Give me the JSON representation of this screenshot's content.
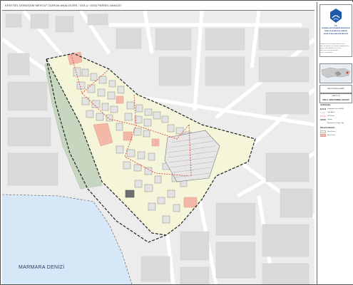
{
  "header": {
    "title": "KENTSEL DÖNÜŞÜM MEVCUT DURUM ANALİZLERİ / DOLU / BOŞ PARSEL ANALİZİ"
  },
  "map": {
    "sea_label": "MARMARA DENİZİ",
    "colors": {
      "background": "#ececec",
      "blocks": "#d9d9d9",
      "sea": "#d6e8f7",
      "park": "#c7d6bf",
      "built_parcel": "#f4f5d9",
      "empty_parcel": "#f4b8a8",
      "boundary": "#222222",
      "analysis_line": "#d83a3a"
    }
  },
  "sidebar": {
    "institution_lines": [
      "T.C.",
      "İSTANBUL BÜYÜKŞEHİR BELEDİYESİ",
      "İMAR VE ŞEHİRCİLİK DAİRESİ",
      "ŞEHİR PLANLAMA MÜDÜRLÜĞÜ"
    ],
    "description_lines": [
      "İSTANBUL BÜYÜKŞEHİR BELEDİYESİ",
      "İMAR VE ŞEHİRCİLİK DAİRESİ BAŞKANLIĞI",
      "ŞEHİR PLANLAMA MÜDÜRLÜĞÜ",
      "KENTSEL DÖNÜŞÜM ALANI",
      "TESPİT ÇALIŞMASI"
    ],
    "title": "Mevcut Durum Analizi",
    "subtitle_small": "ANALİZ 1A",
    "subtitle": "DOLU / BOŞ PARSEL ANALİZİ",
    "legend": {
      "heading": "Açıklamalar",
      "items": [
        {
          "label": "Proje Alanı Sınırı (Mülk)"
        },
        {
          "label": "Yapı Adası"
        },
        {
          "label": "Yol Kenarı"
        },
        {
          "label": "Yapılar"
        },
        {
          "label": "Betonarme / Kargir Yapı"
        }
      ],
      "parcel_heading": "Parsel Kullanımı",
      "parcel_items": [
        {
          "label": "Dolu Parsel",
          "color": "#f4f5d9"
        },
        {
          "label": "Boş Parsel",
          "color": "#f4b8a8"
        }
      ]
    }
  }
}
